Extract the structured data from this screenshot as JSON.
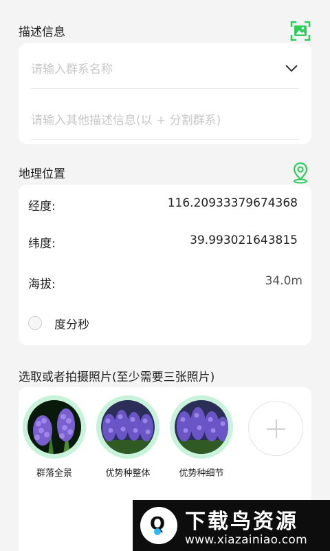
{
  "description": {
    "title": "描述信息",
    "community_name_placeholder": "请输入群系名称",
    "other_desc_placeholder": "请输入其他描述信息(以 + 分割群系)"
  },
  "location": {
    "title": "地理位置",
    "longitude_label": "经度:",
    "longitude_value": "116.20933379674368",
    "latitude_label": "纬度:",
    "latitude_value": "39.993021643815",
    "altitude_label": "海拔:",
    "altitude_value": "34.0m",
    "dms_label": "度分秒"
  },
  "photos": {
    "title": "选取或者拍摄照片(至少需要三张照片)",
    "items": [
      {
        "caption": "群落全景"
      },
      {
        "caption": "优势种整体"
      },
      {
        "caption": "优势种细节"
      }
    ]
  },
  "watermark": {
    "title": "下载鸟资源",
    "url": "www.xiazainiao.com"
  },
  "colors": {
    "accent_green": "#2ecc5a",
    "photo_ring": "#c8f3da",
    "placeholder": "#c8c8c8"
  }
}
